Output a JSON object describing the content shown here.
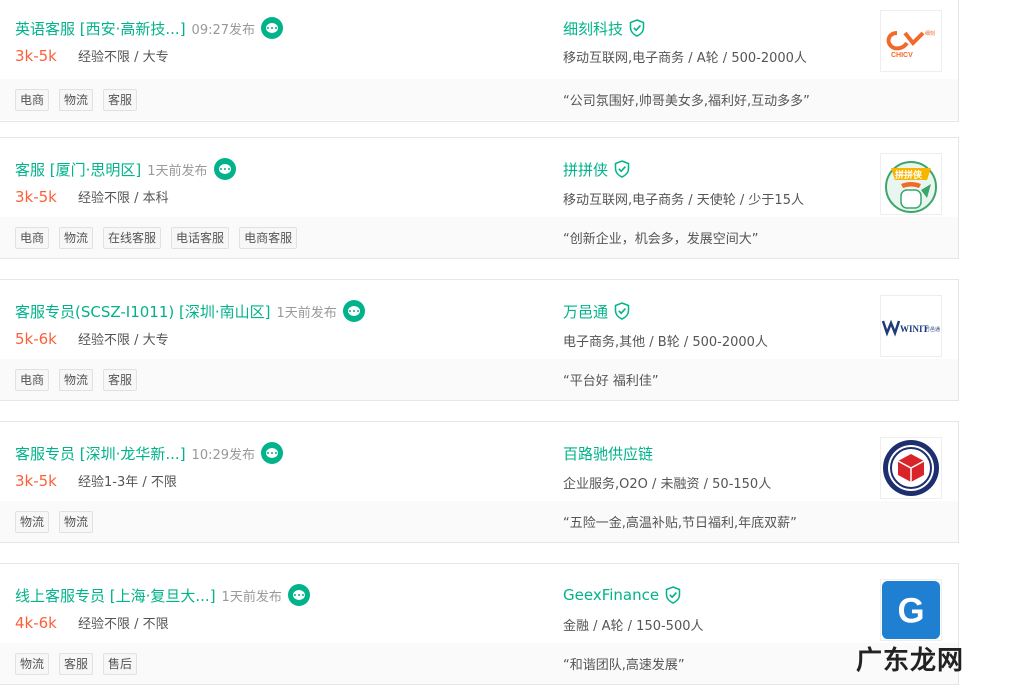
{
  "jobs": [
    {
      "title": "英语客服 [西安·高新技...]",
      "pub_time": "09:27发布",
      "salary": "3k-5k",
      "requirements": "经验不限 / 大专",
      "tags": [
        "电商",
        "物流",
        "客服"
      ],
      "company_name": "细刻科技",
      "company_info": "移动互联网,电子商务 / A轮 / 500-2000人",
      "quote": "“公司氛围好,帅哥美女多,福利好,互动多多”",
      "logo_icon": "chicv-logo-icon",
      "logo_text": "CHICV",
      "logo_small": "细刻"
    },
    {
      "title": "客服 [厦门·思明区]",
      "pub_time": "1天前发布",
      "salary": "3k-5k",
      "requirements": "经验不限 / 本科",
      "tags": [
        "电商",
        "物流",
        "在线客服",
        "电话客服",
        "电商客服"
      ],
      "company_name": "拼拼侠",
      "company_info": "移动互联网,电子商务 / 天使轮 / 少于15人",
      "quote": "“创新企业，机会多，发展空间大”",
      "logo_icon": "pinpinxia-mascot-icon",
      "logo_text": "拼拼侠"
    },
    {
      "title": "客服专员(SCSZ-I1011) [深圳·南山区]",
      "pub_time": "1天前发布",
      "salary": "5k-6k",
      "requirements": "经验不限 / 大专",
      "tags": [
        "电商",
        "物流",
        "客服"
      ],
      "company_name": "万邑通",
      "company_info": "电子商务,其他 / B轮 / 500-2000人",
      "quote": "“平台好 福利佳”",
      "logo_icon": "winit-logo-icon",
      "logo_text": "WINIT",
      "logo_small": "万邑通"
    },
    {
      "title": "客服专员 [深圳·龙华新...]",
      "pub_time": "10:29发布",
      "salary": "3k-5k",
      "requirements": "经验1-3年 / 不限",
      "tags": [
        "物流",
        "物流"
      ],
      "company_name": "百路驰供应链",
      "company_info": "企业服务,O2O / 未融资 / 50-150人",
      "quote": "“五险一金,高温补贴,节日福利,年底双薪”",
      "logo_icon": "cube-circle-logo-icon"
    },
    {
      "title": "线上客服专员 [上海·复旦大...]",
      "pub_time": "1天前发布",
      "salary": "4k-6k",
      "requirements": "经验不限 / 不限",
      "tags": [
        "物流",
        "客服",
        "售后"
      ],
      "company_name": "GeexFinance",
      "company_info": "金融 / A轮 / 150-500人",
      "quote": "“和谐团队,高速发展”",
      "logo_icon": "geex-g-logo-icon",
      "logo_text": "G"
    }
  ],
  "watermark": "广东龙网",
  "colors": {
    "brand_green": "#00b38a",
    "salary_orange": "#fd5f39",
    "muted_gray": "#999999"
  }
}
